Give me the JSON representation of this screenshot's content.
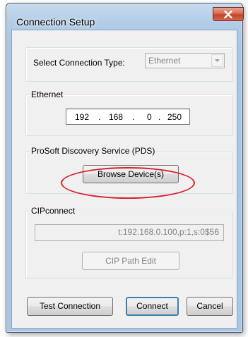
{
  "window": {
    "title": "Connection Setup",
    "close_icon": "close-icon"
  },
  "connection_type": {
    "label": "Select Connection Type:",
    "selected": "Ethernet",
    "disabled": true
  },
  "ethernet": {
    "group_label": "Ethernet",
    "ip": [
      "192",
      "168",
      "0",
      "250"
    ],
    "separator": "."
  },
  "pds": {
    "group_label": "ProSoft Discovery Service (PDS)",
    "browse_label": "Browse Device(s)",
    "highlight_color": "#d8202a"
  },
  "cipconnect": {
    "group_label": "CIPconnect",
    "path_value": "t:192.168.0.100,p:1,s:0$56",
    "edit_label": "CIP Path Edit",
    "disabled": true
  },
  "footer": {
    "test_label": "Test Connection",
    "connect_label": "Connect",
    "cancel_label": "Cancel"
  }
}
